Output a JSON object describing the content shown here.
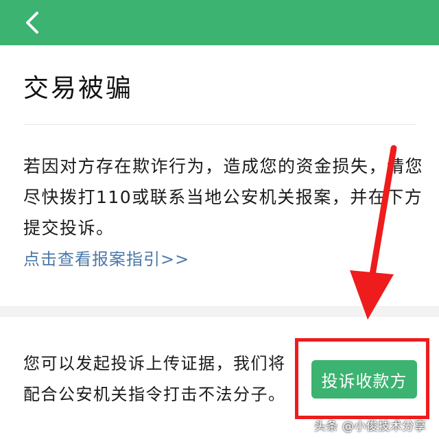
{
  "header": {
    "back_icon": "chevron-left-icon",
    "background_color": "#3cb371"
  },
  "page": {
    "title": "交易被骗",
    "description": "若因对方存在欺诈行为，造成您的资金损失，请您尽快拨打110或联系当地公安机关报案，并在下方提交投诉。",
    "guide_link": "点击查看报案指引>>"
  },
  "complaint": {
    "text": "您可以发起投诉上传证据，我们将配合公安机关指令打击不法分子。",
    "button_label": "投诉收款方",
    "button_color": "#3cb371"
  },
  "annotation": {
    "color": "#ee1c1c"
  },
  "watermark": {
    "text": "头条 @小俊技术分享"
  }
}
